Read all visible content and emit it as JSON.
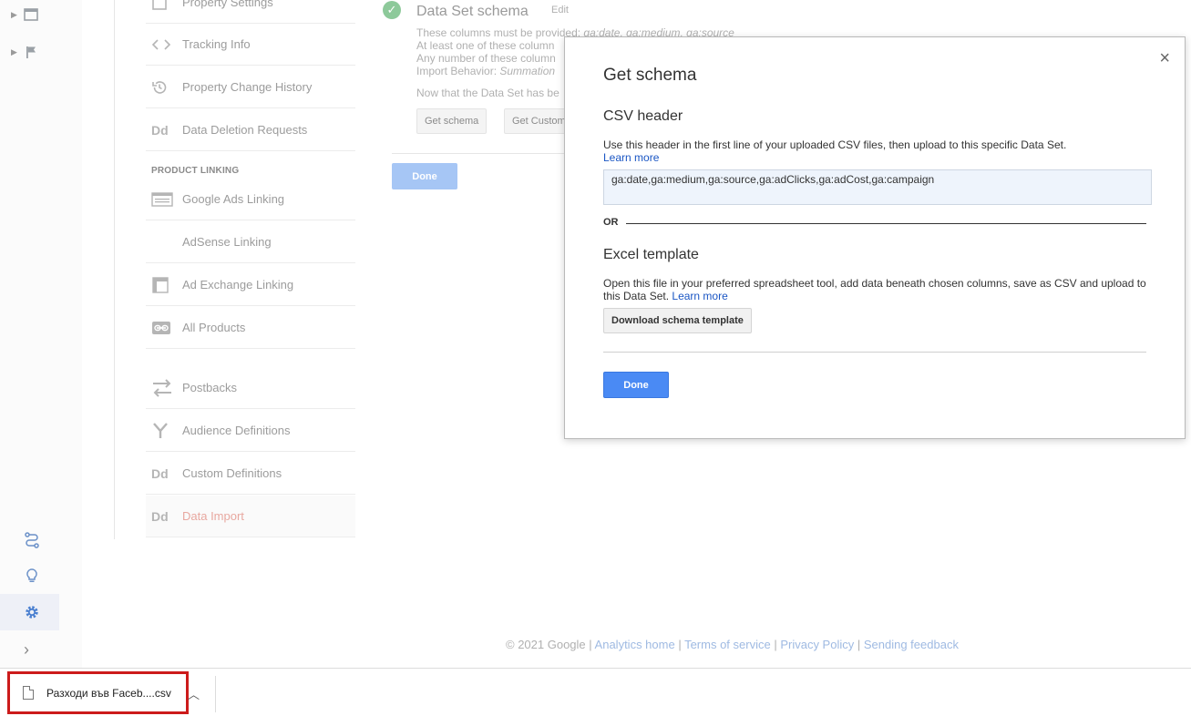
{
  "nav": {
    "items": [
      {
        "label": "Property Settings",
        "icon": "property-settings-icon"
      },
      {
        "label": "Tracking Info",
        "icon": "code-icon"
      },
      {
        "label": "Property Change History",
        "icon": "history-icon"
      },
      {
        "label": "Data Deletion Requests",
        "icon": "dd-icon"
      },
      {
        "label": "Google Ads Linking",
        "icon": "google-ads-icon"
      },
      {
        "label": "AdSense Linking",
        "icon": "adsense-icon"
      },
      {
        "label": "Ad Exchange Linking",
        "icon": "ad-exchange-icon"
      },
      {
        "label": "All Products",
        "icon": "link-icon"
      },
      {
        "label": "Postbacks",
        "icon": "postbacks-icon"
      },
      {
        "label": "Audience Definitions",
        "icon": "audience-icon"
      },
      {
        "label": "Custom Definitions",
        "icon": "dd-icon"
      },
      {
        "label": "Data Import",
        "icon": "dd-icon"
      }
    ],
    "section_product_linking": "PRODUCT LINKING",
    "dd_glyph": "Dd"
  },
  "background": {
    "title": "Data Set schema",
    "edit": "Edit",
    "line1_prefix": "These columns must be provided: ",
    "line1_cols": "ga:date, ga:medium, ga:source",
    "line2": "At least one of these column",
    "line3": "Any number of these column",
    "line4_prefix": "Import Behavior: ",
    "line4_value": "Summation",
    "line5": "Now that the Data Set has be",
    "get_schema": "Get schema",
    "get_custom": "Get Custom",
    "done": "Done"
  },
  "modal": {
    "title": "Get schema",
    "csv_heading": "CSV header",
    "csv_desc": "Use this header in the first line of your uploaded CSV files, then upload to this specific Data Set.",
    "learn_more": "Learn more",
    "csv_value": "ga:date,ga:medium,ga:source,ga:adClicks,ga:adCost,ga:campaign",
    "or": "OR",
    "excel_heading": "Excel template",
    "excel_desc": "Open this file in your preferred spreadsheet tool, add data beneath chosen columns, save as CSV and upload to this Data Set.",
    "download_btn": "Download schema template",
    "done": "Done",
    "close": "×"
  },
  "footer": {
    "copyright": "© 2021 Google",
    "sep": " | ",
    "links": [
      "Analytics home",
      "Terms of service",
      "Privacy Policy",
      "Sending feedback"
    ]
  },
  "download": {
    "filename": "Разходи във Faceb....csv"
  },
  "colors": {
    "accent": "#4a8af4",
    "link": "#1a56c4",
    "highlight_border": "#cc1b1b"
  }
}
